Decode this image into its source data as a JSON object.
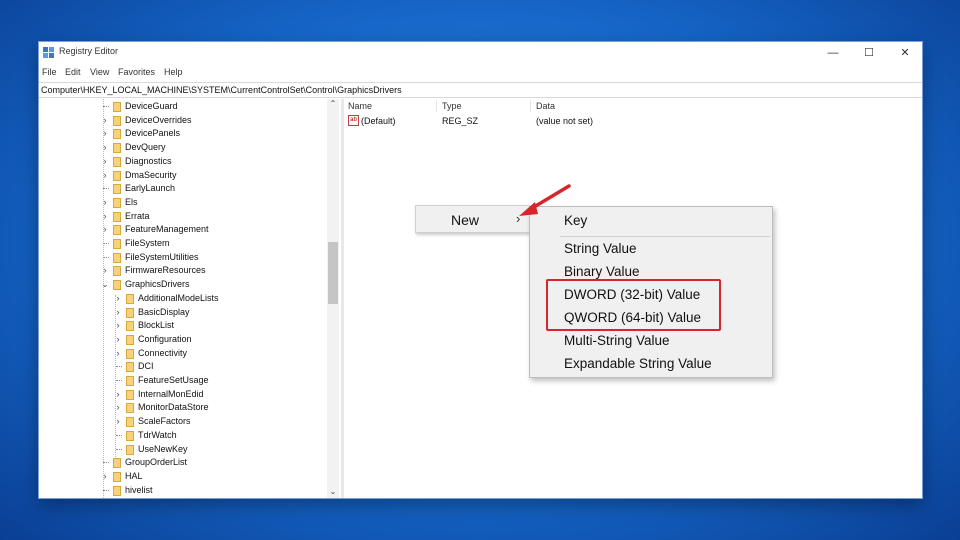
{
  "window": {
    "title": "Registry Editor",
    "controls": {
      "minimize": "—",
      "maximize": "☐",
      "close": "✕"
    }
  },
  "menubar": [
    "File",
    "Edit",
    "View",
    "Favorites",
    "Help"
  ],
  "address": "Computer\\HKEY_LOCAL_MACHINE\\SYSTEM\\CurrentControlSet\\Control\\GraphicsDrivers",
  "tree": {
    "items": [
      {
        "label": "DeviceGuard",
        "level": 0,
        "expander": ""
      },
      {
        "label": "DeviceOverrides",
        "level": 0,
        "expander": "›"
      },
      {
        "label": "DevicePanels",
        "level": 0,
        "expander": "›"
      },
      {
        "label": "DevQuery",
        "level": 0,
        "expander": "›"
      },
      {
        "label": "Diagnostics",
        "level": 0,
        "expander": "›"
      },
      {
        "label": "DmaSecurity",
        "level": 0,
        "expander": "›"
      },
      {
        "label": "EarlyLaunch",
        "level": 0,
        "expander": ""
      },
      {
        "label": "Els",
        "level": 0,
        "expander": "›"
      },
      {
        "label": "Errata",
        "level": 0,
        "expander": "›"
      },
      {
        "label": "FeatureManagement",
        "level": 0,
        "expander": "›"
      },
      {
        "label": "FileSystem",
        "level": 0,
        "expander": ""
      },
      {
        "label": "FileSystemUtilities",
        "level": 0,
        "expander": ""
      },
      {
        "label": "FirmwareResources",
        "level": 0,
        "expander": "›"
      },
      {
        "label": "GraphicsDrivers",
        "level": 0,
        "expander": "⌄"
      },
      {
        "label": "AdditionalModeLists",
        "level": 1,
        "expander": "›"
      },
      {
        "label": "BasicDisplay",
        "level": 1,
        "expander": "›"
      },
      {
        "label": "BlockList",
        "level": 1,
        "expander": "›"
      },
      {
        "label": "Configuration",
        "level": 1,
        "expander": "›"
      },
      {
        "label": "Connectivity",
        "level": 1,
        "expander": "›"
      },
      {
        "label": "DCI",
        "level": 1,
        "expander": ""
      },
      {
        "label": "FeatureSetUsage",
        "level": 1,
        "expander": ""
      },
      {
        "label": "InternalMonEdid",
        "level": 1,
        "expander": "›"
      },
      {
        "label": "MonitorDataStore",
        "level": 1,
        "expander": "›"
      },
      {
        "label": "ScaleFactors",
        "level": 1,
        "expander": "›"
      },
      {
        "label": "TdrWatch",
        "level": 1,
        "expander": ""
      },
      {
        "label": "UseNewKey",
        "level": 1,
        "expander": ""
      },
      {
        "label": "GroupOrderList",
        "level": 0,
        "expander": ""
      },
      {
        "label": "HAL",
        "level": 0,
        "expander": "›"
      },
      {
        "label": "hivelist",
        "level": 0,
        "expander": ""
      }
    ]
  },
  "list": {
    "headers": [
      "Name",
      "Type",
      "Data"
    ],
    "rows": [
      {
        "icon": "ab",
        "name": "(Default)",
        "type": "REG_SZ",
        "data": "(value not set)"
      }
    ]
  },
  "context_menu": {
    "new_label": "New",
    "submenu_arrow": "›",
    "submenu": [
      "Key",
      "String Value",
      "Binary Value",
      "DWORD (32-bit) Value",
      "QWORD (64-bit) Value",
      "Multi-String Value",
      "Expandable String Value"
    ]
  },
  "scroll_arrows": {
    "up": "⌃",
    "down": "⌄"
  },
  "colors": {
    "highlight_box": "#d7252c",
    "arrow": "#d7252c"
  }
}
